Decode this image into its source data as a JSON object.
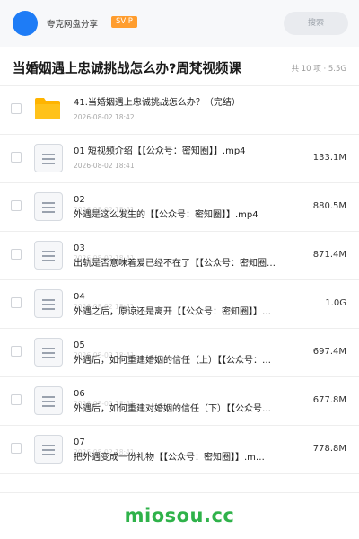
{
  "header": {
    "owner_name": "夸克网盘分享",
    "badge": "SVIP",
    "search_placeholder": "搜索"
  },
  "share": {
    "title": "当婚姻遇上忠诚挑战怎么办?周梵视频课",
    "summary": "共 10 项 · 5.5G"
  },
  "files": [
    {
      "type": "folder",
      "name_line1": "41.当婚姻遇上忠诚挑战怎么办？（完结）",
      "name_line2": "",
      "date": "2026-08-02 18:42",
      "size": ""
    },
    {
      "type": "file",
      "name_line1": "01 短视频介绍【【公众号：密知圈】】.mp4",
      "name_line2": "",
      "date": "2026-08-02 18:41",
      "size": "133.1M"
    },
    {
      "type": "file",
      "name_line1": "02",
      "name_line2": "外遇是这么发生的【【公众号：密知圈】】.mp4",
      "date": "2026-08-02 18:41",
      "size": "880.5M"
    },
    {
      "type": "file",
      "name_line1": "03",
      "name_line2": "出轨是否意味着爱已经不在了【【公众号：密知圈…",
      "date": "2026-08-02 18:41",
      "size": "871.4M"
    },
    {
      "type": "file",
      "name_line1": "04",
      "name_line2": "外遇之后，原谅还是离开【【公众号：密知圈】】…",
      "date": "2026-08-02 18:41",
      "size": "1.0G"
    },
    {
      "type": "file",
      "name_line1": "05",
      "name_line2": "外遇后，如何重建婚姻的信任（上）【【公众号：…",
      "date": "2026-08-02 18:41",
      "size": "697.4M"
    },
    {
      "type": "file",
      "name_line1": "06",
      "name_line2": "外遇后，如何重建对婚姻的信任（下）【【公众号…",
      "date": "2026-08-02 18:41",
      "size": "677.8M"
    },
    {
      "type": "file",
      "name_line1": "07",
      "name_line2": "把外遇变成一份礼物【【公众号：密知圈】】.m…",
      "date": "2026-08-02 18:41",
      "size": "778.8M"
    }
  ],
  "watermark": "miosou.cc",
  "colors": {
    "accent": "#1e7cf6",
    "badge": "#ff9d2e",
    "folder": "#ffc21a",
    "watermark": "#2fb24a"
  }
}
